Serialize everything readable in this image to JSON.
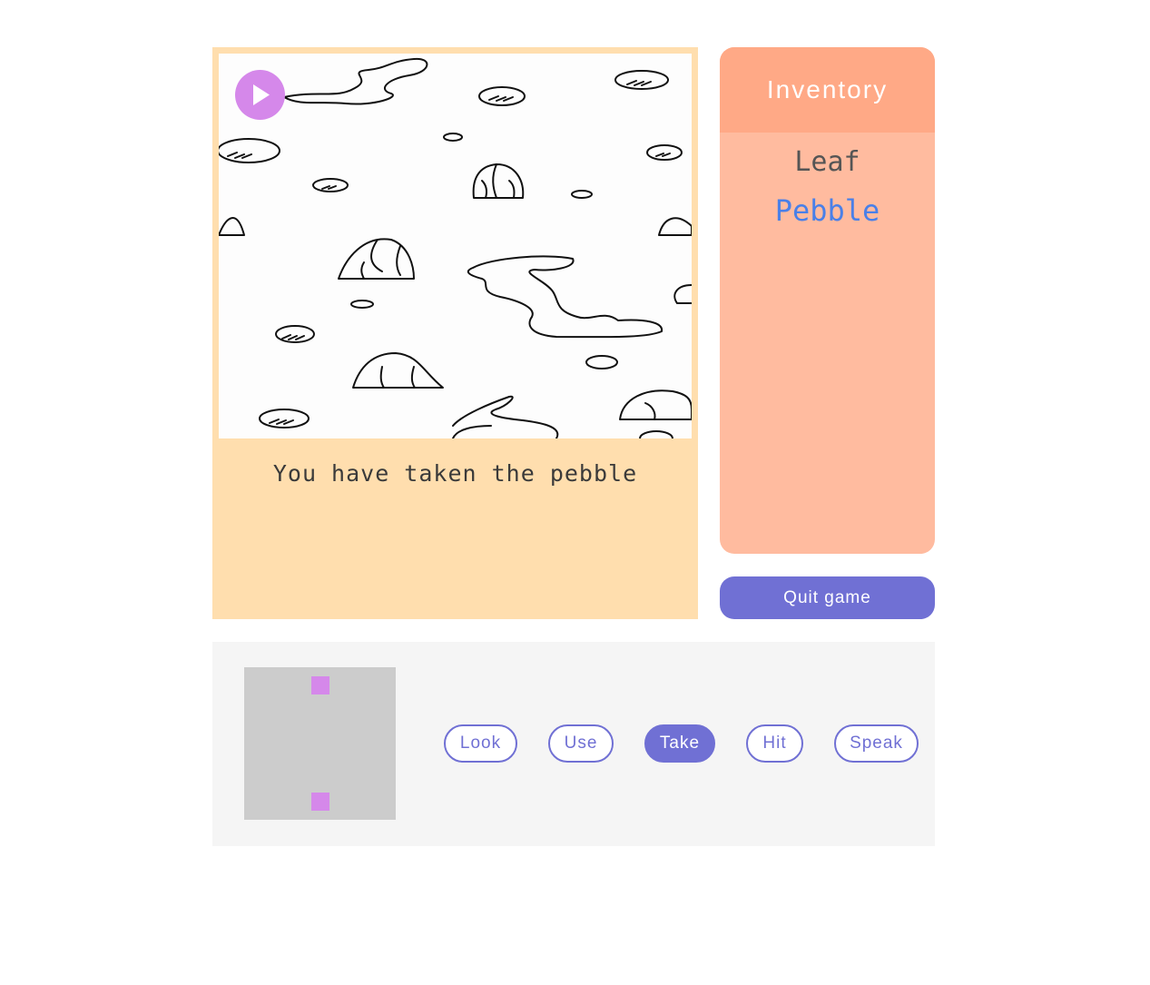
{
  "scene": {
    "play_icon": "play-icon",
    "message": "You have taken the pebble"
  },
  "inventory": {
    "title": "Inventory",
    "items": [
      {
        "label": "Leaf",
        "selected": false
      },
      {
        "label": "Pebble",
        "selected": true
      }
    ]
  },
  "quit_label": "Quit game",
  "minimap": {
    "exits": [
      "north",
      "south"
    ]
  },
  "verbs": [
    {
      "label": "Look",
      "active": false
    },
    {
      "label": "Use",
      "active": false
    },
    {
      "label": "Take",
      "active": true
    },
    {
      "label": "Hit",
      "active": false
    },
    {
      "label": "Speak",
      "active": false
    }
  ],
  "colors": {
    "scene_panel": "#ffdeae",
    "inventory_body": "#ffbb9f",
    "inventory_header": "#ffa986",
    "accent": "#7070d4",
    "play_button": "#d588ea",
    "selected_item": "#4a80e8"
  }
}
